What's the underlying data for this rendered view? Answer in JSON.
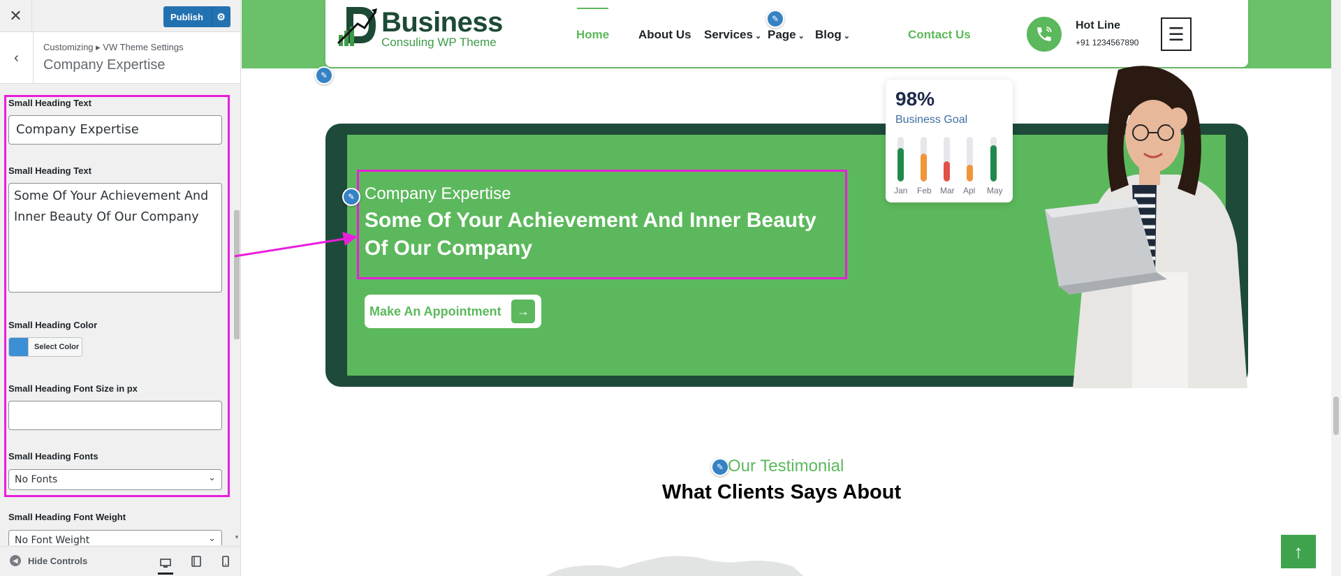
{
  "customizer": {
    "close_icon": "close-icon",
    "publish_label": "Publish",
    "breadcrumb": "Customizing ▸ VW Theme Settings",
    "section_title": "Company Expertise",
    "controls": {
      "small_heading_label": "Small Heading Text",
      "small_heading_value": "Company Expertise",
      "heading_label": "Small Heading Text",
      "heading_value": "Some Of Your Achievement And Inner Beauty Of Our Company",
      "color_label": "Small Heading Color",
      "color_button": "Select Color",
      "color_swatch": "#3d8fd5",
      "font_size_label": "Small Heading Font Size in px",
      "font_size_value": "",
      "fonts_label": "Small Heading Fonts",
      "fonts_value": "No Fonts",
      "weight_label": "Small Heading Font Weight",
      "weight_value": "No Font Weight"
    },
    "footer": {
      "hide_controls": "Hide Controls",
      "devices": [
        "desktop",
        "tablet",
        "mobile"
      ]
    }
  },
  "site": {
    "logo_name": "Business",
    "logo_tagline": "Consuling WP Theme",
    "nav": [
      "Home",
      "About Us",
      "Services",
      "Page",
      "Blog",
      "Contact Us"
    ],
    "hotline_title": "Hot Line",
    "hotline_number": "+91 1234567890",
    "banner": {
      "small_heading": "Company Expertise",
      "heading": "Some Of Your Achievement And Inner Beauty Of Our Company",
      "button_label": "Make An Appointment"
    },
    "goal_card": {
      "percent": "98%",
      "label": "Business Goal",
      "months": [
        "Jan",
        "Feb",
        "Mar",
        "Apl",
        "May"
      ],
      "levels": [
        0.75,
        0.62,
        0.45,
        0.38,
        0.82
      ],
      "colors": [
        "#1f8a4c",
        "#f0953a",
        "#e2504a",
        "#f0953a",
        "#1f8a4c"
      ]
    },
    "testimonial": {
      "small_heading": "Our Testimonial",
      "heading": "What Clients Says About"
    }
  },
  "colors": {
    "accent_green": "#5cb85c",
    "dark_green": "#1e4a3a",
    "highlight": "#e91eda",
    "wp_blue": "#2271b1"
  }
}
